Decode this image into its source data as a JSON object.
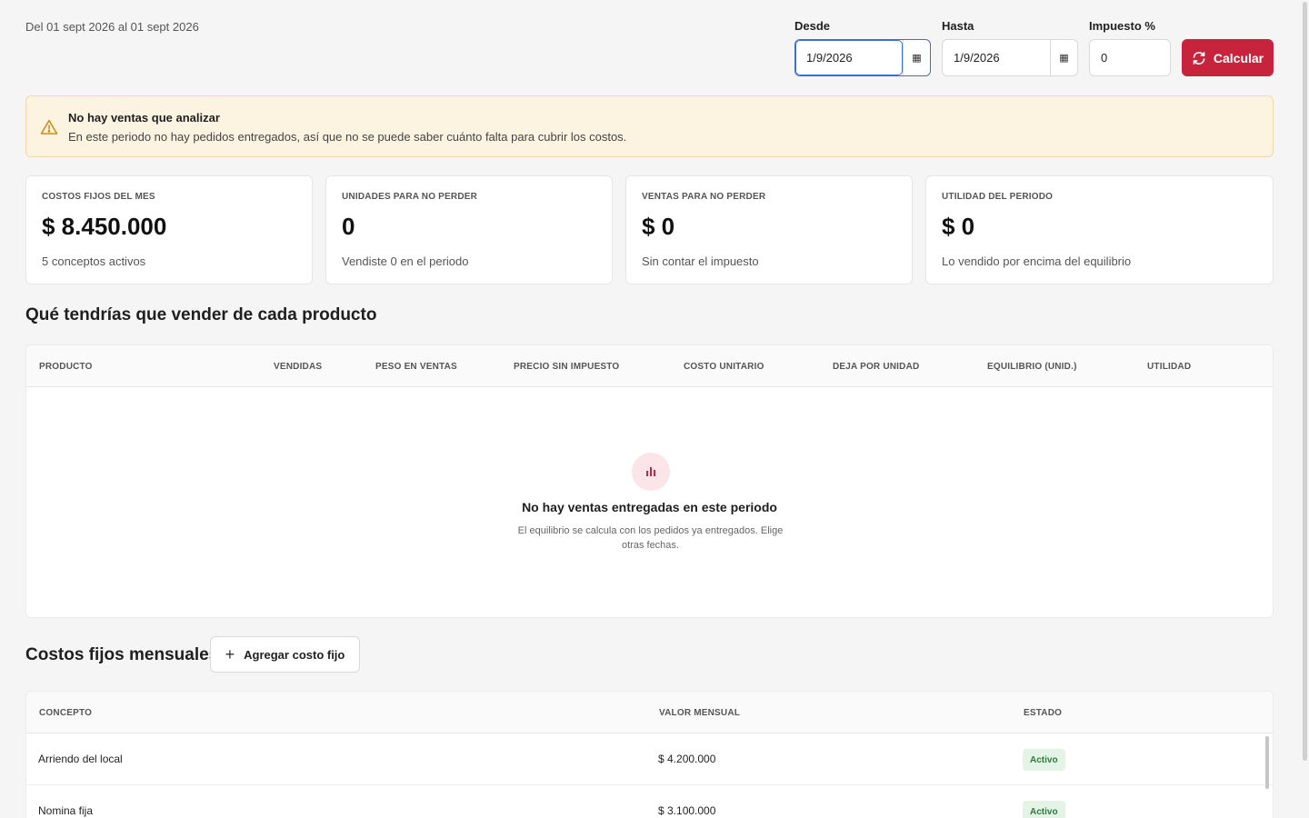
{
  "header": {
    "period_text": "Del 01 sept 2026 al 01 sept 2026"
  },
  "filters": {
    "from_label": "Desde",
    "from_value": "1/9/2026",
    "to_label": "Hasta",
    "to_value": "1/9/2026",
    "tax_label": "Impuesto %",
    "tax_value": "0",
    "calc_label": "Calcular"
  },
  "alert": {
    "title": "No hay ventas que analizar",
    "text": "En este periodo no hay pedidos entregados, así que no se puede saber cuánto falta para cubrir los costos."
  },
  "kpis": [
    {
      "label": "COSTOS FIJOS DEL MES",
      "value": "$ 8.450.000",
      "sub": "5 conceptos activos"
    },
    {
      "label": "UNIDADES PARA NO PERDER",
      "value": "0",
      "sub": "Vendiste 0 en el periodo"
    },
    {
      "label": "VENTAS PARA NO PERDER",
      "value": "$ 0",
      "sub": "Sin contar el impuesto"
    },
    {
      "label": "UTILIDAD DEL PERIODO",
      "value": "$ 0",
      "sub": "Lo vendido por encima del equilibrio"
    }
  ],
  "products": {
    "title": "Qué tendrías que vender de cada producto",
    "columns": [
      "PRODUCTO",
      "VENDIDAS",
      "PESO EN VENTAS",
      "PRECIO SIN IMPUESTO",
      "COSTO UNITARIO",
      "DEJA POR UNIDAD",
      "EQUILIBRIO (UNID.)",
      "UTILIDAD"
    ],
    "empty_title": "No hay ventas entregadas en este periodo",
    "empty_text": "El equilibrio se calcula con los pedidos ya entregados. Elige otras fechas."
  },
  "costs": {
    "title": "Costos fijos mensuales",
    "add_label": "Agregar costo fijo",
    "columns": [
      "CONCEPTO",
      "VALOR MENSUAL",
      "ESTADO"
    ],
    "rows": [
      {
        "concept": "Arriendo del local",
        "value": "$ 4.200.000",
        "status": "Activo"
      },
      {
        "concept": "Nomina fija",
        "value": "$ 3.100.000",
        "status": "Activo"
      }
    ]
  },
  "colors": {
    "accent": "#c8233c",
    "alert_bg": "#fdf3e1",
    "badge_bg": "#e3f4e6",
    "badge_text": "#2d7a3d"
  },
  "icons": {
    "calendar": "calendar-icon",
    "refresh": "refresh-icon",
    "warning": "warning-icon",
    "chart": "bar-chart-icon",
    "plus": "plus-icon"
  }
}
